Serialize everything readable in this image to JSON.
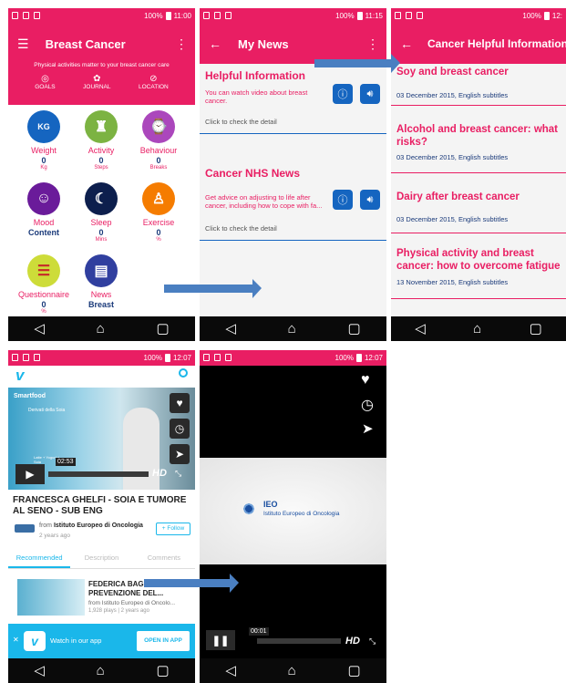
{
  "status": {
    "battery": "100%",
    "t1": "11:00",
    "t2": "11:15",
    "t3": "12:",
    "t4": "12:07",
    "t5": "12:07"
  },
  "s1": {
    "title": "Breast Cancer",
    "tagline": "Physical activities matter to your breast cancer care",
    "tabs": [
      {
        "icon": "◎",
        "label": "GOALS"
      },
      {
        "icon": "✿",
        "label": "JOURNAL"
      },
      {
        "icon": "⊘",
        "label": "LOCATION"
      }
    ],
    "tiles": [
      {
        "label": "Weight",
        "value": "0",
        "unit": "Kg",
        "color": "#1565c0",
        "icon": "KG"
      },
      {
        "label": "Activity",
        "value": "0",
        "unit": "Steps",
        "color": "#7cb342",
        "icon": "♜"
      },
      {
        "label": "Behaviour",
        "value": "0",
        "unit": "Breaks",
        "color": "#ab47bc",
        "icon": "⌚"
      },
      {
        "label": "Mood",
        "value": "Content",
        "unit": "",
        "color": "#6a1b9a",
        "icon": "☺"
      },
      {
        "label": "Sleep",
        "value": "0",
        "unit": "Mins",
        "color": "#0d1f4d",
        "icon": "☾"
      },
      {
        "label": "Exercise",
        "value": "0",
        "unit": "%",
        "color": "#f57c00",
        "icon": "♙"
      },
      {
        "label": "Questionnaire",
        "value": "0",
        "unit": "%",
        "color": "#cddc39",
        "icon": "☰"
      },
      {
        "label": "News",
        "value": "Breast",
        "unit": "",
        "color": "#303f9f",
        "icon": "▤"
      }
    ]
  },
  "s2": {
    "title": "My News",
    "sec1": "Helpful Information",
    "sec1_text": "You can watch video about breast cancer.",
    "sec1_link": "Click to check the detail",
    "sec2": "Cancer NHS News",
    "sec2_text": "Get advice on adjusting to life after cancer, including how to cope with fa...",
    "sec2_link": "Click to check the detail"
  },
  "s3": {
    "title": "Cancer Helpful Information",
    "articles": [
      {
        "title": "Soy and breast cancer",
        "date": "03 December 2015, English subtitles"
      },
      {
        "title": "Alcohol and breast cancer: what risks?",
        "date": "03 December 2015, English subtitles"
      },
      {
        "title": "Dairy after breast cancer",
        "date": "03 December 2015, English subtitles"
      },
      {
        "title": "Physical activity and breast cancer: how to overcome fatigue",
        "date": "13 November 2015, English subtitles"
      }
    ]
  },
  "s4": {
    "logo": "v",
    "video_brand": "Smartfood",
    "video_sub": "Derivati della Soia",
    "video_sub2": "Latte + Yogurt + Soia",
    "time": "02:53",
    "hd": "HD",
    "title": "FRANCESCA GHELFI - SOIA E TUMORE AL SENO - SUB ENG",
    "from_label": "from",
    "from_name": "Istituto Europeo di Oncologia",
    "age": "2 years ago",
    "follow": "+ Follow",
    "tabs": [
      "Recommended",
      "Description",
      "Comments"
    ],
    "rel_title": "FEDERICA BAG... PREVENZIONE DEL...",
    "rel_from": "from Istituto Europeo di Oncolo...",
    "rel_meta": "1,928 plays | 2 years ago",
    "banner": "Watch in our app",
    "open": "OPEN IN APP"
  },
  "s5": {
    "ieo": "IEO",
    "ieo_sub": "Istituto Europeo di Oncologia",
    "time": "00:01",
    "hd": "HD"
  },
  "colors": {
    "accent": "#e91e63",
    "blue": "#1565c0",
    "vimeo": "#1ab7ea"
  }
}
